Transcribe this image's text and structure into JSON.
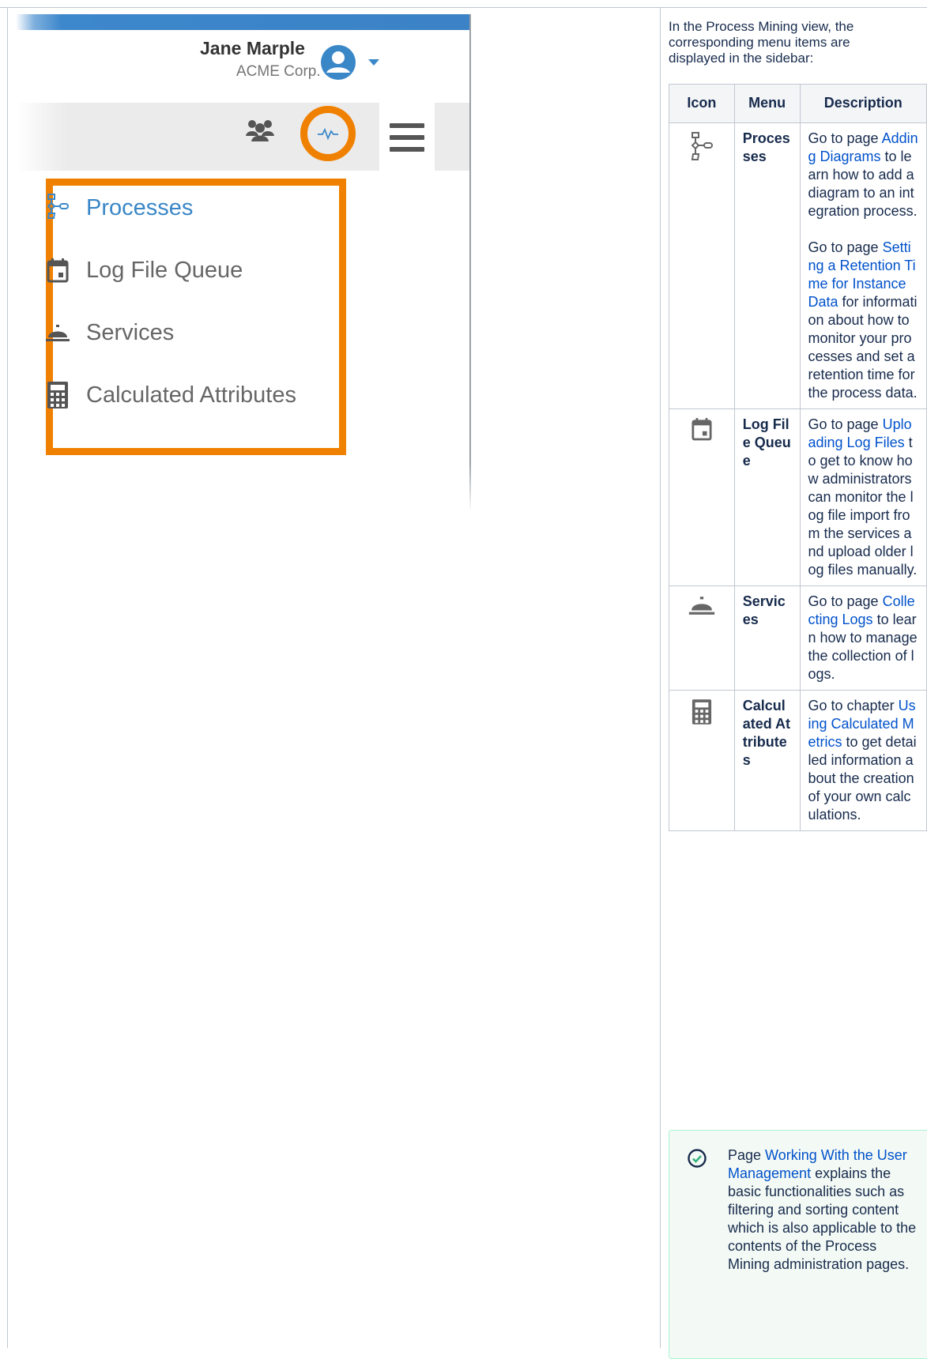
{
  "screenshot": {
    "user": {
      "name": "Jane Marple",
      "org": "ACME Corp."
    },
    "toolbar_icons": [
      "team-icon",
      "activity-icon",
      "hamburger-menu-icon"
    ],
    "menu": [
      {
        "label": "Processes",
        "icon": "process-diagram-icon",
        "active": true
      },
      {
        "label": "Log File Queue",
        "icon": "calendar-icon",
        "active": false
      },
      {
        "label": "Services",
        "icon": "service-bell-icon",
        "active": false
      },
      {
        "label": "Calculated Attributes",
        "icon": "calculator-icon",
        "active": false
      }
    ],
    "colors": {
      "highlight": "#f08000",
      "accent": "#3a87c8",
      "topbar": "#3b82c6"
    }
  },
  "intro": "In the Process Mining view, the corresponding menu items are displayed in the sidebar:",
  "table": {
    "headers": {
      "icon": "Icon",
      "menu": "Menu",
      "description": "Description"
    },
    "rows": [
      {
        "icon": "process-diagram-icon",
        "menu": "Processes",
        "p1_pre": "Go to page ",
        "p1_link": "Adding Diagrams",
        "p1_post": " to learn how to add a diagram to an integration process.",
        "p2_pre": "Go to page ",
        "p2_link": "Setting a Retention Time for Instance Data",
        "p2_post": " for information about how to monitor your processes and set a retention time for the process data."
      },
      {
        "icon": "calendar-icon",
        "menu": "Log File Queue",
        "pre": "Go to page ",
        "link": "Uploading Log Files",
        "post": " to get to know how administrators can monitor the log file import from the services and upload older log files manually."
      },
      {
        "icon": "service-bell-icon",
        "menu": "Services",
        "pre": "Go to page ",
        "link": "Collecting Logs",
        "post": " to learn how to manage the collection of logs."
      },
      {
        "icon": "calculator-icon",
        "menu": "Calculated Attributes",
        "pre": "Go to chapter ",
        "link": "Using Calculated Metrics",
        "post": " to get detailed information about the creation of your own calculations."
      }
    ]
  },
  "note": {
    "pre": "Page ",
    "link": "Working With the User Management",
    "post": " explains the basic functionalities such as filtering and sorting content which is also applicable to the contents of the Process Mining administration pages.",
    "icon": "check-circle-icon",
    "color": "#36b37e"
  }
}
